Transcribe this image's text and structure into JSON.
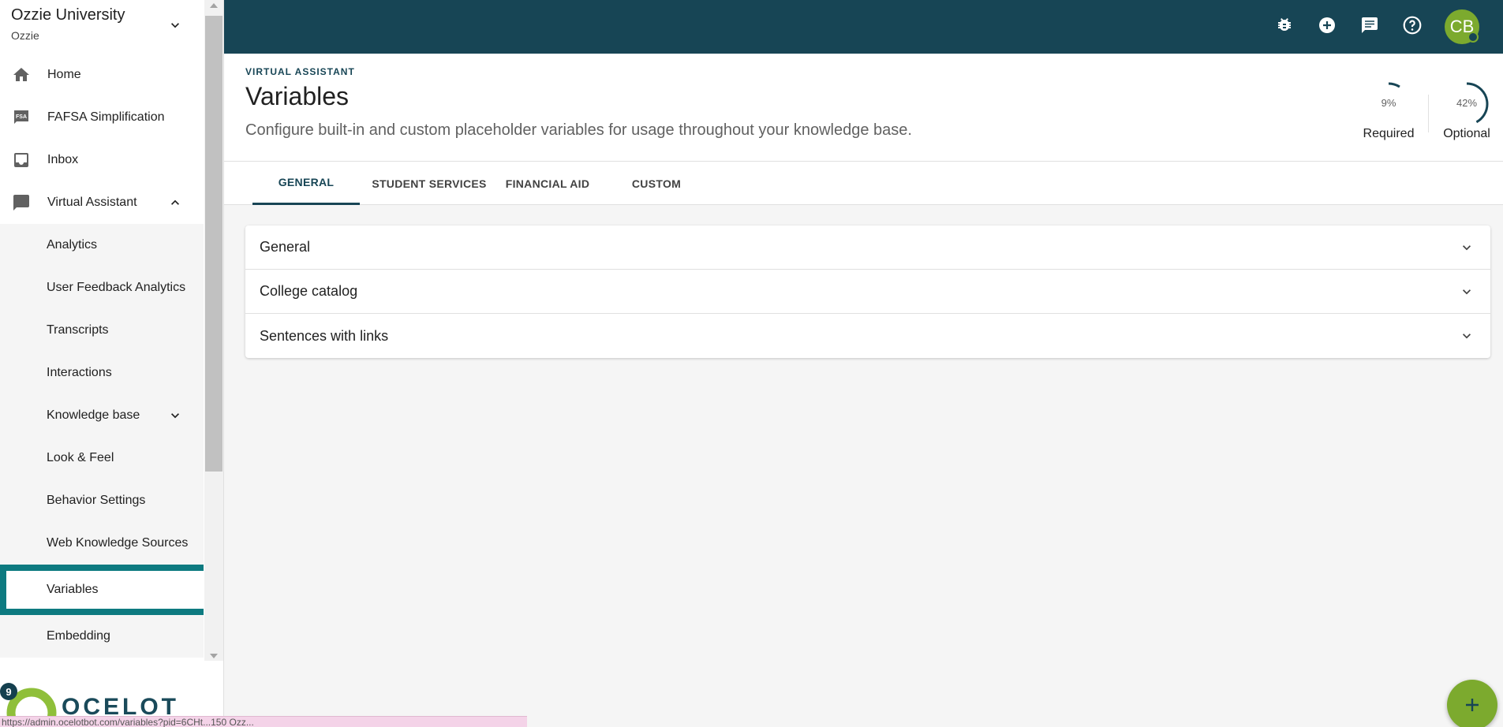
{
  "org": {
    "name": "Ozzie University",
    "sub": "Ozzie"
  },
  "nav": {
    "home": "Home",
    "fafsa": "FAFSA Simplification",
    "fafsa_badge": "FSA",
    "inbox": "Inbox",
    "virtual_assistant": "Virtual Assistant",
    "sub_items": {
      "analytics": "Analytics",
      "user_feedback": "User Feedback Analytics",
      "transcripts": "Transcripts",
      "interactions": "Interactions",
      "knowledge_base": "Knowledge base",
      "look_feel": "Look & Feel",
      "behavior": "Behavior Settings",
      "web_sources": "Web Knowledge Sources",
      "variables": "Variables",
      "embedding": "Embedding"
    }
  },
  "logo": {
    "text": "OCELOT",
    "badge": "9"
  },
  "topbar": {
    "avatar": "CB",
    "icons": [
      "bug-icon",
      "add-circle-icon",
      "chat-icon",
      "help-icon"
    ]
  },
  "header": {
    "eyebrow": "VIRTUAL ASSISTANT",
    "title": "Variables",
    "description": "Configure built-in and custom placeholder variables for usage throughout your knowledge base.",
    "required": {
      "pct": "9%",
      "label": "Required",
      "value": 9
    },
    "optional": {
      "pct": "42%",
      "label": "Optional",
      "value": 42
    }
  },
  "tabs": [
    "GENERAL",
    "STUDENT SERVICES",
    "FINANCIAL AID",
    "CUSTOM"
  ],
  "accordion": [
    "General",
    "College catalog",
    "Sentences with links"
  ],
  "colors": {
    "topbar": "#174555",
    "accent": "#7caa2e",
    "active_border": "#0d7a80"
  },
  "statusbar": "https://admin.ocelotbot.com/variables?pid=6CHt...150 Ozz..."
}
